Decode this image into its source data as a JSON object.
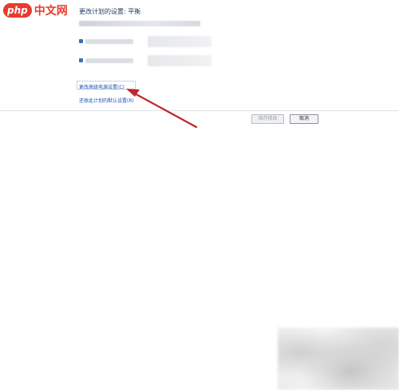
{
  "logo": {
    "badge": "php",
    "text": "中文网"
  },
  "plan": {
    "title": "更改计划的设置: 平衡"
  },
  "links": {
    "advanced_settings": "更改高级电源设置(C)",
    "restore_defaults": "还原此计划的默认设置(R)"
  },
  "buttons": {
    "save": "保存修改",
    "cancel": "取消"
  },
  "colors": {
    "accent_link": "#1a56b3",
    "arrow": "#c0262d",
    "logo": "#e63b2e"
  }
}
